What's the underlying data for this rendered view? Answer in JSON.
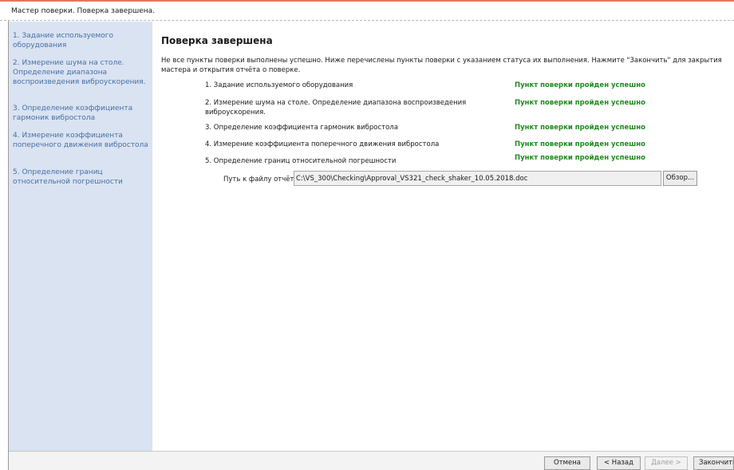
{
  "window": {
    "title": "Мастер поверки. Поверка завершена."
  },
  "sidebar": {
    "steps": [
      "1.  Задание используемого оборудования",
      "2.  Измерение шума на столе. Определение диапазона воспроизведения виброускорения.",
      "3.  Определение коэффициента гармоник вибростола",
      "4.  Измерение коэффициента поперечного движения вибростола",
      "5.  Определение границ относительной погрешности"
    ]
  },
  "main": {
    "heading": "Поверка завершена",
    "description": "Не все пункты поверки выполнены успешно. Ниже перечислены пункты поверки с указанием статуса их выполнения. Нажмите \"Закончить\" для закрытия мастера и открытия отчёта о поверке.",
    "results": [
      {
        "name": "1.  Задание используемого оборудования",
        "status": "Пункт поверки пройден успешно"
      },
      {
        "name": "2.  Измерение шума на столе. Определение диапазона воспроизведения виброускорения.",
        "status": "Пункт поверки пройден успешно"
      },
      {
        "name": "3.  Определение коэффициента гармоник вибростола",
        "status": "Пункт поверки пройден успешно"
      },
      {
        "name": "4.  Измерение коэффициента поперечного движения вибростола",
        "status": "Пункт поверки пройден успешно"
      },
      {
        "name": "5.  Определение границ относительной погрешности",
        "status": "Пункт поверки пройден успешно"
      }
    ],
    "report_path_label": "Путь к файлу отчёта",
    "report_path_value": "C:\\VS_300\\Checking\\Approval_VS321_check_shaker_10.05.2018.doc",
    "browse_label": "Обзор..."
  },
  "footer": {
    "cancel_label": "Отмена",
    "back_label": "< Назад",
    "next_label": "Далее >",
    "finish_label": "Закончить"
  },
  "colors": {
    "sidebar_bg": "#d9e3f2",
    "sidebar_text": "#4a6fa3",
    "success": "#1e8a1e",
    "accent": "#e0795f"
  }
}
